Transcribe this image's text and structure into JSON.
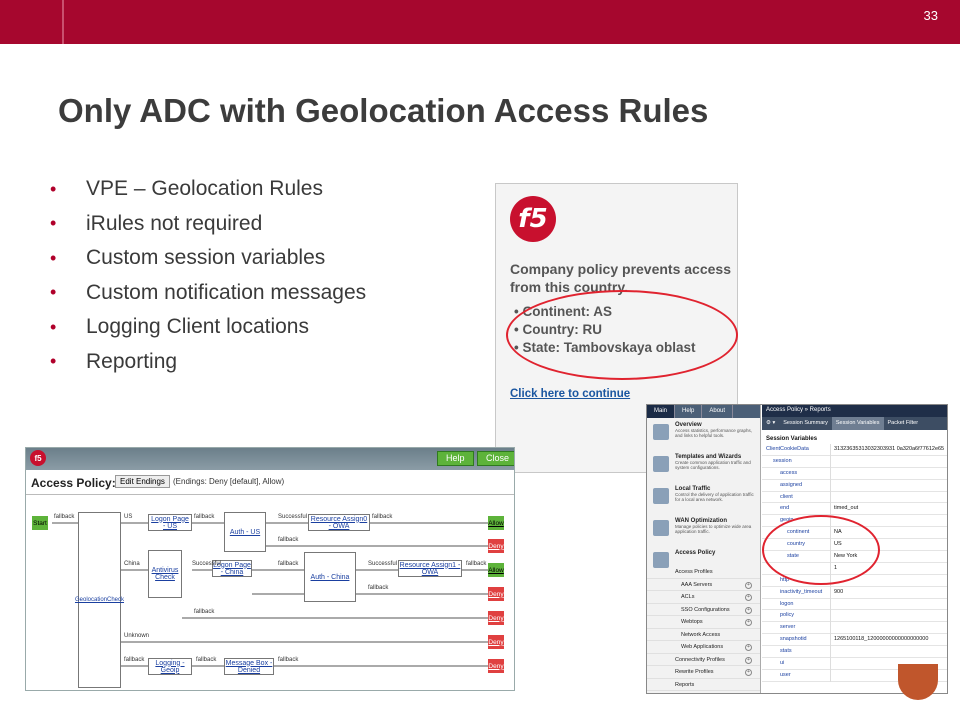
{
  "slide": {
    "page_number": "33",
    "title": "Only ADC with Geolocation Access Rules"
  },
  "bullets": [
    "VPE – Geolocation Rules",
    "iRules not required",
    "Custom session variables",
    "Custom notification messages",
    "Logging Client locations",
    "Reporting"
  ],
  "dialog": {
    "logo": "f5",
    "message": "Company policy prevents access from this country.",
    "items": [
      "Continent: AS",
      "Country: RU",
      "State: Tambovskaya oblast"
    ],
    "link": "Click here to continue"
  },
  "access_policy": {
    "logo": "f5",
    "help": "Help",
    "close": "Close",
    "title": "Access Policy: owa",
    "edit_endings": "Edit Endings",
    "endings": "(Endings: Deny [default], Allow)",
    "start": "Start",
    "geolocation": "GeolocationCheck",
    "antivirus": "Antivirus Check",
    "logon_us": "Logon Page - US",
    "logon_china": "Logon Page - China",
    "logging_geoip": "Logging - Geoip",
    "message_box": "Message Box - Denied",
    "auth_us": "Auth - US",
    "auth_china": "Auth - China",
    "resource_owa": "Resource Assign0 - OWA",
    "resource1_owa": "Resource Assign1 - OWA",
    "allow": "Allow",
    "deny": "Deny",
    "fallback": "fallback",
    "successful": "Successful",
    "us": "US",
    "china": "China",
    "unknown": "Unknown"
  },
  "admin": {
    "tabs": [
      "Main",
      "Help",
      "About"
    ],
    "sections": [
      {
        "title": "Overview",
        "desc": "Access statistics, performance graphs, and links to helpful tools."
      },
      {
        "title": "Templates and Wizards",
        "desc": "Create common application traffic and system configurations."
      },
      {
        "title": "Local Traffic",
        "desc": "Control the delivery of application traffic for a local area network."
      },
      {
        "title": "WAN Optimization",
        "desc": "Manage policies to optimize wide area application traffic."
      },
      {
        "title": "Access Policy",
        "desc": ""
      }
    ],
    "submenu": [
      "Access Profiles",
      "AAA Servers",
      "ACLs",
      "SSO Configurations",
      "Webtops",
      "Network Access",
      "Web Applications",
      "Connectivity Profiles",
      "Rewrite Profiles",
      "Reports"
    ],
    "breadcrumb": "Access Policy » Reports",
    "report_tabs": [
      "Session Summary",
      "Session Variables",
      "Packet Filter"
    ],
    "session_variables": "Session Variables",
    "rows": [
      {
        "k": "ClientCookieData",
        "v": "31323635313032303931 0a320a6f77612e65",
        "indent": 0
      },
      {
        "k": "session",
        "v": "",
        "indent": 1
      },
      {
        "k": "access",
        "v": "",
        "indent": 2
      },
      {
        "k": "assigned",
        "v": "",
        "indent": 2
      },
      {
        "k": "client",
        "v": "",
        "indent": 2
      },
      {
        "k": "end",
        "v": "timed_out",
        "indent": 2
      },
      {
        "k": "geoip",
        "v": "",
        "indent": 2
      },
      {
        "k": "continent",
        "v": "NA",
        "indent": 3
      },
      {
        "k": "country",
        "v": "US",
        "indent": 3
      },
      {
        "k": "state",
        "v": "New York",
        "indent": 3
      },
      {
        "k": "",
        "v": "1",
        "indent": 2
      },
      {
        "k": "http",
        "v": "",
        "indent": 2
      },
      {
        "k": "inactivity_timeout",
        "v": "900",
        "indent": 2
      },
      {
        "k": "logon",
        "v": "",
        "indent": 2
      },
      {
        "k": "policy",
        "v": "",
        "indent": 2
      },
      {
        "k": "server",
        "v": "",
        "indent": 2
      },
      {
        "k": "snapshotid",
        "v": "1265100118_12000000000000000000",
        "indent": 2
      },
      {
        "k": "stats",
        "v": "",
        "indent": 2
      },
      {
        "k": "ui",
        "v": "",
        "indent": 2
      },
      {
        "k": "user",
        "v": "",
        "indent": 2
      }
    ]
  },
  "colors": {
    "brand": "#a6072e",
    "highlight_ring": "#e0232f",
    "allow": "#5db33a",
    "deny": "#e04040"
  }
}
